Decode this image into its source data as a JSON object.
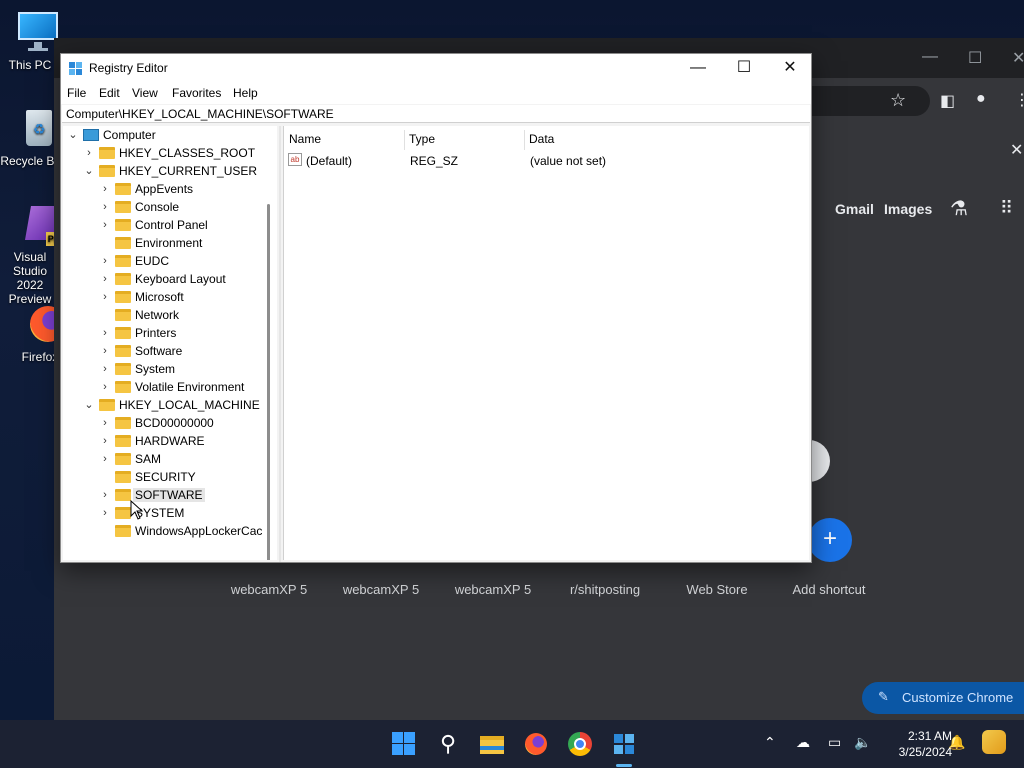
{
  "desktop": {
    "icons": [
      {
        "label": "This PC",
        "icon": "monitor-icon"
      },
      {
        "label": "Recycle Bin",
        "icon": "recycle-bin-icon"
      },
      {
        "label": "Visual Studio 2022 Preview",
        "icon": "visual-studio-icon"
      },
      {
        "label": "Firefox",
        "icon": "firefox-icon"
      }
    ]
  },
  "chrome": {
    "header_links": [
      "Gmail",
      "Images"
    ],
    "shortcuts": [
      "webcamXP 5",
      "webcamXP 5",
      "webcamXP 5",
      "r/shitposting",
      "Web Store",
      "Add shortcut"
    ],
    "customize_label": "Customize Chrome",
    "add_symbol": "+"
  },
  "regedit": {
    "title": "Registry Editor",
    "menu": [
      "File",
      "Edit",
      "View",
      "Favorites",
      "Help"
    ],
    "address": "Computer\\HKEY_LOCAL_MACHINE\\SOFTWARE",
    "tree": [
      {
        "label": "Computer",
        "expanded": true
      },
      {
        "label": "HKEY_CLASSES_ROOT",
        "expanded": false
      },
      {
        "label": "HKEY_CURRENT_USER",
        "expanded": true
      },
      {
        "label": "AppEvents",
        "expanded": false
      },
      {
        "label": "Console",
        "expanded": false
      },
      {
        "label": "Control Panel",
        "expanded": false
      },
      {
        "label": "Environment",
        "expanded": null
      },
      {
        "label": "EUDC",
        "expanded": false
      },
      {
        "label": "Keyboard Layout",
        "expanded": false
      },
      {
        "label": "Microsoft",
        "expanded": false
      },
      {
        "label": "Network",
        "expanded": null
      },
      {
        "label": "Printers",
        "expanded": false
      },
      {
        "label": "Software",
        "expanded": false
      },
      {
        "label": "System",
        "expanded": false
      },
      {
        "label": "Volatile Environment",
        "expanded": false
      },
      {
        "label": "HKEY_LOCAL_MACHINE",
        "expanded": true
      },
      {
        "label": "BCD00000000",
        "expanded": false
      },
      {
        "label": "HARDWARE",
        "expanded": false
      },
      {
        "label": "SAM",
        "expanded": false
      },
      {
        "label": "SECURITY",
        "expanded": null
      },
      {
        "label": "SOFTWARE",
        "expanded": false,
        "selected": true
      },
      {
        "label": "SYSTEM",
        "expanded": false
      },
      {
        "label": "WindowsAppLockerCac",
        "expanded": null
      }
    ],
    "columns": [
      "Name",
      "Type",
      "Data"
    ],
    "values": [
      {
        "name": "(Default)",
        "type": "REG_SZ",
        "data": "(value not set)",
        "icon": "ab-string-icon"
      }
    ]
  },
  "taskbar": {
    "apps": [
      "start-icon",
      "search-icon",
      "file-explorer-icon",
      "firefox-icon",
      "chrome-icon",
      "regedit-icon"
    ],
    "time": "2:31 AM",
    "date": "3/25/2024"
  }
}
